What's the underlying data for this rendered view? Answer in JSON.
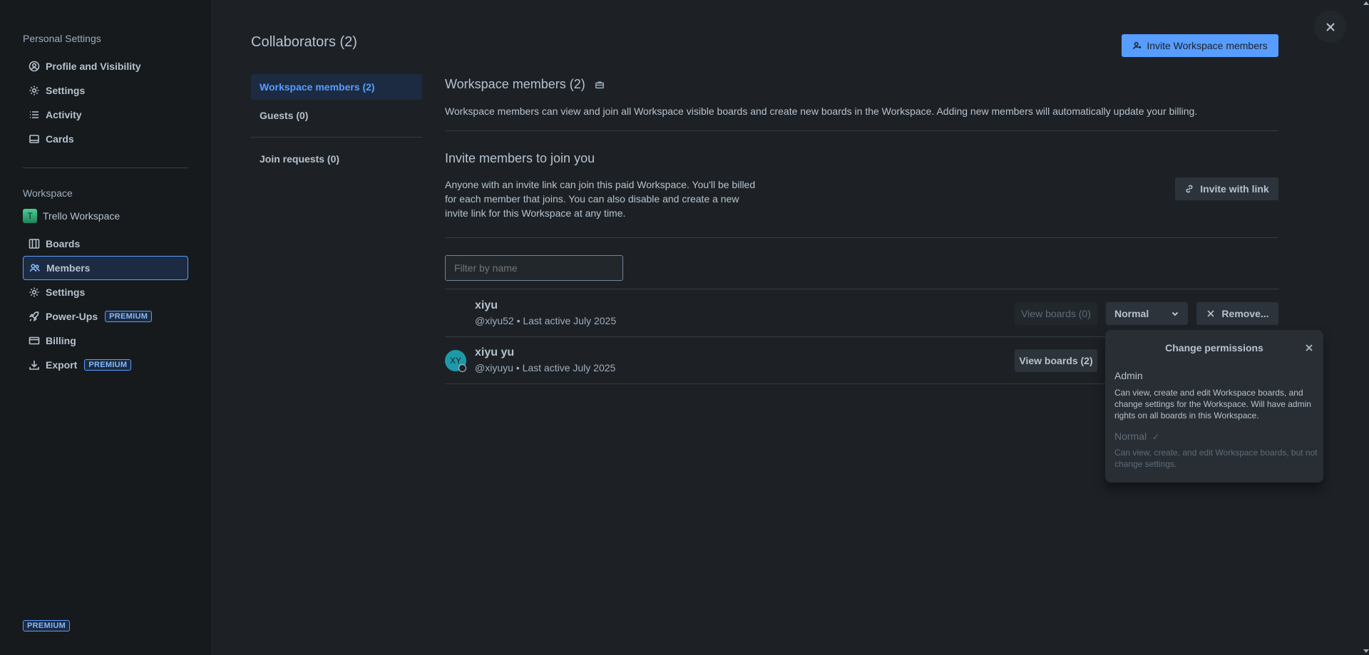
{
  "sidebar": {
    "personal_heading": "Personal Settings",
    "personal_items": [
      {
        "label": "Profile and Visibility",
        "icon": "user-circle-icon"
      },
      {
        "label": "Settings",
        "icon": "gear-icon"
      },
      {
        "label": "Activity",
        "icon": "activity-list-icon"
      },
      {
        "label": "Cards",
        "icon": "card-icon"
      }
    ],
    "workspace_heading": "Workspace",
    "workspace_logo_letter": "T",
    "workspace_name": "Trello Workspace",
    "workspace_items": [
      {
        "label": "Boards",
        "icon": "boards-icon"
      },
      {
        "label": "Members",
        "icon": "members-icon",
        "active": true
      },
      {
        "label": "Settings",
        "icon": "gear-icon"
      },
      {
        "label": "Power-Ups",
        "icon": "rocket-icon",
        "badge": "PREMIUM"
      },
      {
        "label": "Billing",
        "icon": "credit-card-icon"
      },
      {
        "label": "Export",
        "icon": "download-icon",
        "badge": "PREMIUM"
      }
    ],
    "footer_badge": "PREMIUM"
  },
  "header": {
    "title": "Collaborators (2)",
    "invite_button": "Invite Workspace members"
  },
  "tabs": [
    {
      "label": "Workspace members (2)",
      "active": true
    },
    {
      "label": "Guests (0)"
    },
    {
      "label": "Join requests (0)"
    }
  ],
  "members_section": {
    "title": "Workspace members (2)",
    "description": "Workspace members can view and join all Workspace visible boards and create new boards in the Workspace. Adding new members will automatically update your billing."
  },
  "invite_section": {
    "title": "Invite members to join you",
    "description": "Anyone with an invite link can join this paid Workspace. You'll be billed for each member that joins. You can also disable and create a new invite link for this Workspace at any time.",
    "button": "Invite with link"
  },
  "filter": {
    "placeholder": "Filter by name"
  },
  "members": [
    {
      "name": "xiyu",
      "meta": "@xiyu52 • Last active July 2025",
      "view_boards": "View boards (0)",
      "role": "Normal",
      "remove": "Remove..."
    },
    {
      "name": "xiyu yu",
      "initials": "XY",
      "meta": "@xiyuyu • Last active July 2025",
      "view_boards": "View boards (2)"
    }
  ],
  "popover": {
    "title": "Change permissions",
    "options": [
      {
        "title": "Admin",
        "description": "Can view, create and edit Workspace boards, and change settings for the Workspace. Will have admin rights on all boards in this Workspace."
      },
      {
        "title": "Normal",
        "check": "✓",
        "description": "Can view, create, and edit Workspace boards, but not change settings."
      }
    ]
  },
  "colors": {
    "accent": "#579dff",
    "background": "#1d2125",
    "sidebar": "#161a1d"
  }
}
